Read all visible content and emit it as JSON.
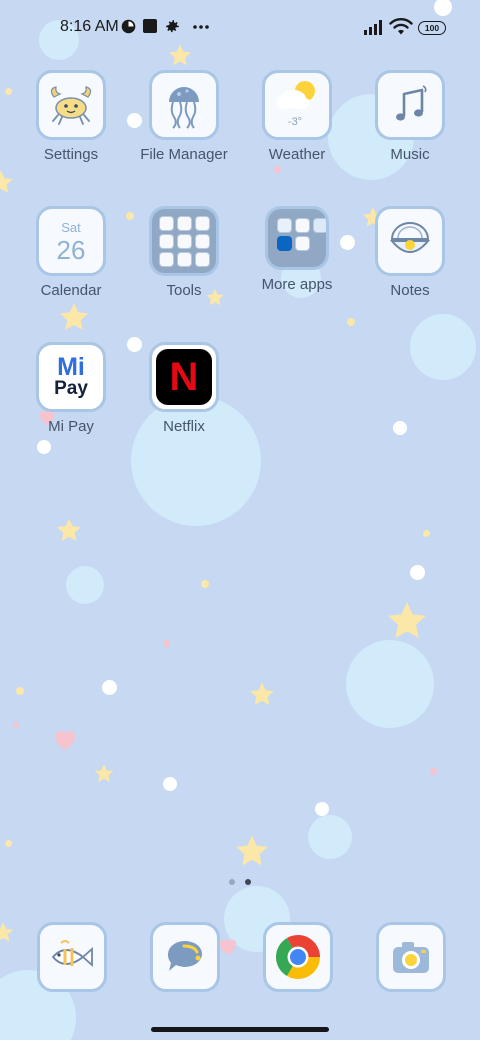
{
  "status_bar": {
    "time": "8:16 AM",
    "battery": "100"
  },
  "apps": [
    {
      "label": "Settings",
      "icon": "crab-icon"
    },
    {
      "label": "File Manager",
      "icon": "jellyfish-icon"
    },
    {
      "label": "Weather",
      "icon": "weather-sun-cloud-icon",
      "temperature": "-3°"
    },
    {
      "label": "Music",
      "icon": "music-note-icon"
    },
    {
      "label": "Calendar",
      "icon": "calendar-icon",
      "day": "Sat",
      "date": "26"
    },
    {
      "label": "Tools",
      "icon": "folder-icon"
    },
    {
      "label": "More apps",
      "icon": "folder-icon"
    },
    {
      "label": "Notes",
      "icon": "pearl-shell-icon"
    },
    {
      "label": "Mi Pay",
      "icon": "mi-pay-icon",
      "logo_top": "Mi",
      "logo_bottom": "Pay"
    },
    {
      "label": "Netflix",
      "icon": "netflix-icon",
      "logo": "N"
    }
  ],
  "dock": [
    {
      "icon": "fish-icon"
    },
    {
      "icon": "chat-bubble-icon"
    },
    {
      "icon": "chrome-icon"
    },
    {
      "icon": "camera-icon"
    }
  ],
  "colors": {
    "wallpaper": "#c6d8f2",
    "tile_border": "#a9c6e6",
    "label_text": "#45556a",
    "netflix_red": "#e50914",
    "mipay_blue": "#2f6fde"
  }
}
